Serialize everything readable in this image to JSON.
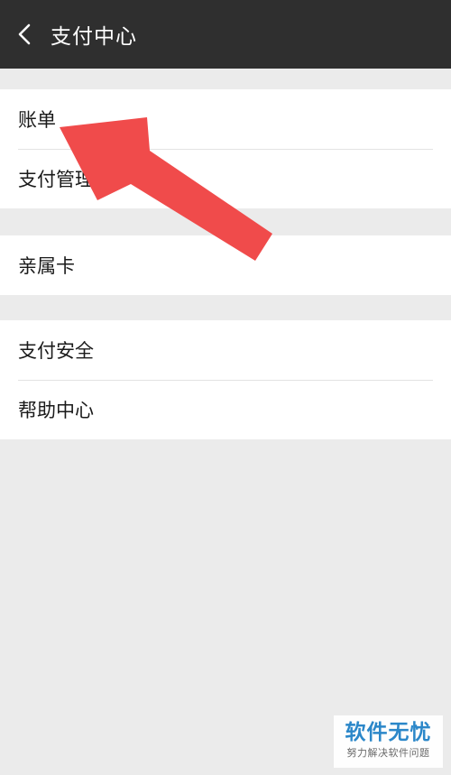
{
  "header": {
    "title": "支付中心",
    "back_icon": "chevron-left-icon"
  },
  "groups": [
    {
      "items": [
        {
          "label": "账单"
        },
        {
          "label": "支付管理"
        }
      ]
    },
    {
      "items": [
        {
          "label": "亲属卡"
        }
      ]
    },
    {
      "items": [
        {
          "label": "支付安全"
        },
        {
          "label": "帮助中心"
        }
      ]
    }
  ],
  "annotation": {
    "arrow_color": "#f04b4b",
    "points_to": "账单"
  },
  "watermark": {
    "title": "软件无忧",
    "subtitle": "努力解决软件问题",
    "color": "#2b87c9"
  },
  "colors": {
    "header_bg": "#2f2f2f",
    "page_bg": "#ebebeb",
    "item_bg": "#ffffff"
  }
}
